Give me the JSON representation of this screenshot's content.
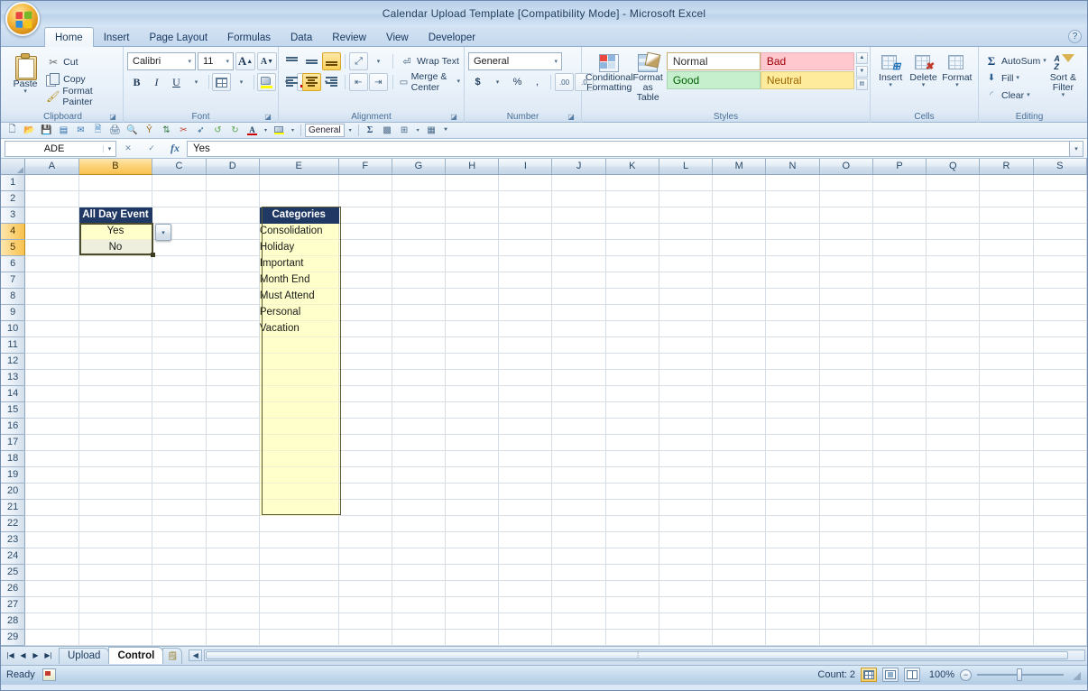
{
  "window": {
    "title": "Calendar Upload Template  [Compatibility Mode] - Microsoft Excel",
    "office_button": "office-button",
    "help": "?"
  },
  "ribbon": {
    "tabs": [
      {
        "label": "Home",
        "active": true
      },
      {
        "label": "Insert",
        "active": false
      },
      {
        "label": "Page Layout",
        "active": false
      },
      {
        "label": "Formulas",
        "active": false
      },
      {
        "label": "Data",
        "active": false
      },
      {
        "label": "Review",
        "active": false
      },
      {
        "label": "View",
        "active": false
      },
      {
        "label": "Developer",
        "active": false
      }
    ],
    "groups": {
      "clipboard": {
        "label": "Clipboard",
        "paste": "Paste",
        "cut": "Cut",
        "copy": "Copy",
        "format_painter": "Format Painter"
      },
      "font": {
        "label": "Font",
        "font_name": "Calibri",
        "font_size": "11",
        "grow_font": "A",
        "shrink_font": "A",
        "bold": "B",
        "italic": "I",
        "underline": "U"
      },
      "alignment": {
        "label": "Alignment",
        "wrap_text": "Wrap Text",
        "merge_center": "Merge & Center"
      },
      "number": {
        "label": "Number",
        "format": "General",
        "currency": "$",
        "percent": "%",
        "comma": ","
      },
      "styles": {
        "label": "Styles",
        "conditional_formatting": "Conditional Formatting",
        "format_as_table": "Format as Table",
        "normal": "Normal",
        "bad": "Bad",
        "good": "Good",
        "neutral": "Neutral"
      },
      "cells": {
        "label": "Cells",
        "insert": "Insert",
        "delete": "Delete",
        "format": "Format"
      },
      "editing": {
        "label": "Editing",
        "autosum": "AutoSum",
        "fill": "Fill",
        "clear": "Clear",
        "sort_filter": "Sort & Filter"
      }
    }
  },
  "quick_toolbar": {
    "number_format": "General",
    "icons": [
      "new-icon",
      "open-icon",
      "save-icon",
      "save-as-icon",
      "print-preview-icon",
      "print-icon",
      "print-quick-icon",
      "preview-icon",
      "sort-asc-icon",
      "filter-icon",
      "cut-red-icon",
      "paste-special-icon",
      "undo-icon",
      "redo-icon",
      "font-color-icon",
      "fill-color-icon",
      "autosum-icon",
      "function-icon",
      "borders-icon",
      "chart-icon",
      "more-icon"
    ]
  },
  "formula_bar": {
    "name_box": "ADE",
    "fx": "fx",
    "value": "Yes"
  },
  "grid": {
    "columns": [
      "A",
      "B",
      "C",
      "D",
      "E",
      "F",
      "G",
      "H",
      "I",
      "J",
      "K",
      "L",
      "M",
      "N",
      "O",
      "P",
      "Q",
      "R",
      "S"
    ],
    "selected_column": "B",
    "rows": [
      1,
      2,
      3,
      4,
      5,
      6,
      7,
      8,
      9,
      10,
      11,
      12,
      13,
      14,
      15,
      16,
      17,
      18,
      19,
      20,
      21,
      22,
      23,
      24,
      25,
      26,
      27,
      28,
      29
    ],
    "selected_rows": [
      4,
      5
    ],
    "cells": {
      "B3": {
        "text": "All Day Event",
        "style": "header"
      },
      "B4": {
        "text": "Yes",
        "style": "yellow-center"
      },
      "B5": {
        "text": "No",
        "style": "pale-center"
      },
      "E3": {
        "text": "Categories",
        "style": "header"
      },
      "E4": {
        "text": "Consolidation",
        "style": "yellow"
      },
      "E5": {
        "text": "Holiday",
        "style": "yellow"
      },
      "E6": {
        "text": "Important",
        "style": "yellow"
      },
      "E7": {
        "text": "Month End",
        "style": "yellow"
      },
      "E8": {
        "text": "Must Attend",
        "style": "yellow"
      },
      "E9": {
        "text": "Personal",
        "style": "yellow"
      },
      "E10": {
        "text": "Vacation",
        "style": "yellow"
      }
    },
    "validation_dropdown": "data-validation-dropdown"
  },
  "sheet_tabs": {
    "tabs": [
      {
        "label": "Upload",
        "active": false
      },
      {
        "label": "Control",
        "active": true
      }
    ],
    "insert_sheet": "insert-worksheet"
  },
  "status_bar": {
    "mode": "Ready",
    "count": "Count: 2",
    "zoom": "100%",
    "zoom_out": "−",
    "zoom_in": "+",
    "views": [
      "normal-view",
      "page-layout-view",
      "page-break-view"
    ]
  },
  "colors": {
    "header_navy": "#1f3864",
    "cell_yellow": "#ffffcc",
    "cell_pale": "#eef0dd",
    "selection_border": "#4b4b2e",
    "selected_header": "#f8c14f",
    "style_bad_bg": "#ffc7ce",
    "style_good_bg": "#c6efce",
    "style_neutral_bg": "#ffeb9c"
  }
}
